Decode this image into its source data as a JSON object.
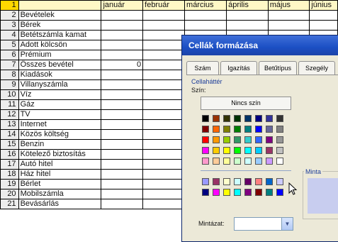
{
  "sheet": {
    "columns": [
      "január",
      "február",
      "március",
      "április",
      "május",
      "június"
    ],
    "header_row_number": "1",
    "rows": [
      {
        "n": "2",
        "label": "Bevételek",
        "value": ""
      },
      {
        "n": "3",
        "label": "Bérek",
        "value": ""
      },
      {
        "n": "4",
        "label": "Betétszámla kamat",
        "value": ""
      },
      {
        "n": "5",
        "label": "Adott kölcsön",
        "value": ""
      },
      {
        "n": "6",
        "label": "Prémium",
        "value": ""
      },
      {
        "n": "7",
        "label": "Összes bevétel",
        "value": "0"
      },
      {
        "n": "8",
        "label": "Kiadások",
        "value": ""
      },
      {
        "n": "9",
        "label": "Villanyszámla",
        "value": ""
      },
      {
        "n": "10",
        "label": "Víz",
        "value": ""
      },
      {
        "n": "11",
        "label": "Gáz",
        "value": ""
      },
      {
        "n": "12",
        "label": "TV",
        "value": ""
      },
      {
        "n": "13",
        "label": "Internet",
        "value": ""
      },
      {
        "n": "14",
        "label": "Közös költség",
        "value": ""
      },
      {
        "n": "15",
        "label": "Benzin",
        "value": ""
      },
      {
        "n": "16",
        "label": "Kötelező biztosítás",
        "value": ""
      },
      {
        "n": "17",
        "label": "Autó hitel",
        "value": ""
      },
      {
        "n": "18",
        "label": "Ház hitel",
        "value": ""
      },
      {
        "n": "19",
        "label": "Bérlet",
        "value": ""
      },
      {
        "n": "20",
        "label": "Mobilszámla",
        "value": ""
      },
      {
        "n": "21",
        "label": "Bevásárlás",
        "value": ""
      }
    ]
  },
  "dialog": {
    "title": "Cellák formázása",
    "tabs": [
      "Szám",
      "Igazítás",
      "Betűtípus",
      "Szegély"
    ],
    "cell_background_label": "Cellaháttér",
    "color_label": "Szín:",
    "no_color_button": "Nincs szín",
    "sample_label": "Minta",
    "sample_color": "#c8cdef",
    "pattern_label": "Mintázat:",
    "pattern_value": "",
    "palette_top": [
      [
        "#000000",
        "#993300",
        "#333300",
        "#003300",
        "#003366",
        "#000080",
        "#333399",
        "#333333"
      ],
      [
        "#800000",
        "#ff6600",
        "#808000",
        "#008000",
        "#008080",
        "#0000ff",
        "#666699",
        "#808080"
      ],
      [
        "#ff0000",
        "#ff9900",
        "#99cc00",
        "#339966",
        "#33cccc",
        "#3366ff",
        "#800080",
        "#969696"
      ],
      [
        "#ff00ff",
        "#ffcc00",
        "#ffff00",
        "#00ff00",
        "#00ffff",
        "#00ccff",
        "#993366",
        "#c0c0c0"
      ],
      [
        "#ff99cc",
        "#ffcc99",
        "#ffff99",
        "#ccffcc",
        "#ccffff",
        "#99ccff",
        "#cc99ff",
        "#ffffff"
      ]
    ],
    "palette_bottom": [
      [
        "#9999ff",
        "#993366",
        "#ffffcc",
        "#ccffff",
        "#660066",
        "#ff8080",
        "#0066cc",
        "#ccccff"
      ],
      [
        "#000080",
        "#ff00ff",
        "#ffff00",
        "#00ffff",
        "#800080",
        "#800000",
        "#008080",
        "#0000ff"
      ]
    ]
  }
}
